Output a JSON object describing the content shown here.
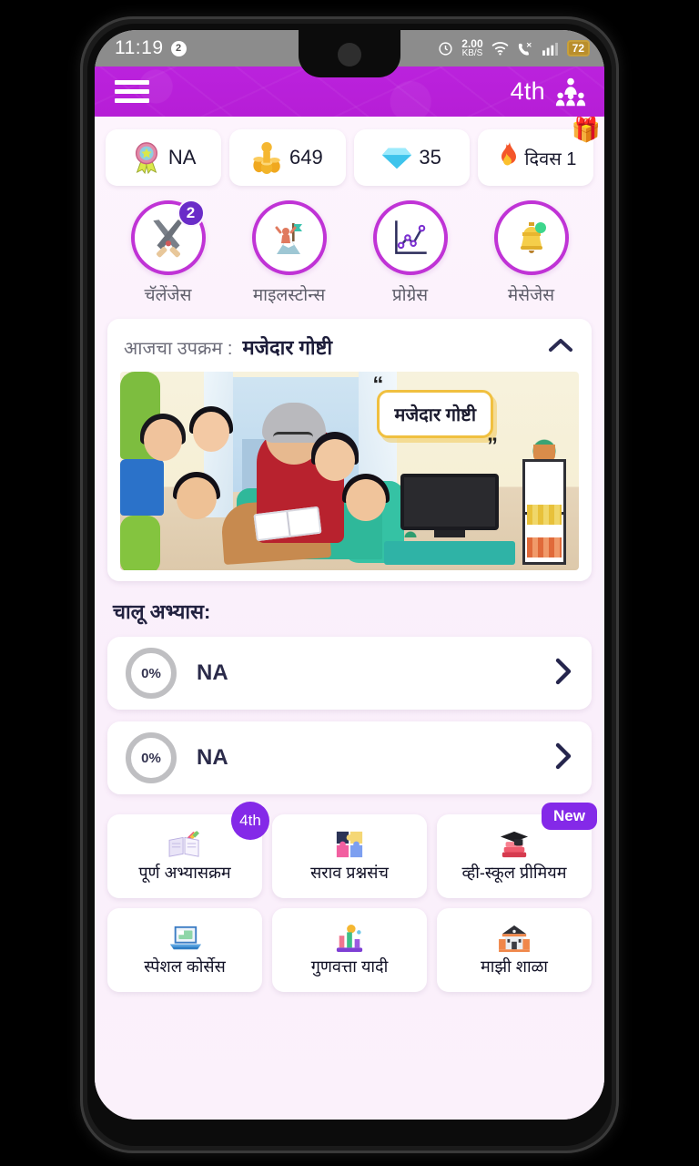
{
  "status_bar": {
    "time": "11:19",
    "notification_count": "2",
    "network_speed_value": "2.00",
    "network_speed_unit": "KB/S",
    "battery_percent": "72",
    "icons": [
      "alarm-clock-icon",
      "wifi-icon",
      "call-icon",
      "signal-icon",
      "battery-icon"
    ]
  },
  "header": {
    "menu_icon": "hamburger-menu-icon",
    "grade_label": "4th",
    "profile_icon": "group-people-icon",
    "background_color": "#b61ed6"
  },
  "stats": [
    {
      "icon": "award-ribbon-icon",
      "value": "NA"
    },
    {
      "icon": "coin-stack-icon",
      "value": "649"
    },
    {
      "icon": "diamond-icon",
      "value": "35"
    },
    {
      "icon": "fire-streak-icon",
      "value": "दिवस 1",
      "corner_icon": "gift-icon"
    }
  ],
  "nav_items": [
    {
      "icon": "crossed-swords-icon",
      "label": "चॅलेंजेस",
      "badge": "2"
    },
    {
      "icon": "mountain-flag-icon",
      "label": "माइलस्टोन्स",
      "badge": ""
    },
    {
      "icon": "line-chart-icon",
      "label": "प्रोग्रेस",
      "badge": ""
    },
    {
      "icon": "bell-icon",
      "label": "मेसेजेस",
      "badge": ""
    }
  ],
  "activity": {
    "label": "आजचा उपक्रम :",
    "title": "मजेदार गोष्टी",
    "toggle_icon": "chevron-up-icon",
    "illustration_bubble_text": "मजेदार गोष्टी",
    "illustration_alt": "grandmother-reading-story-to-children"
  },
  "current_studies": {
    "section_title": "चालू अभ्यास:",
    "rows": [
      {
        "progress": "0%",
        "name": "NA",
        "arrow_icon": "chevron-right-icon"
      },
      {
        "progress": "0%",
        "name": "NA",
        "arrow_icon": "chevron-right-icon"
      }
    ]
  },
  "tiles": [
    {
      "icon": "open-book-pencils-icon",
      "label": "पूर्ण अभ्यासक्रम",
      "badge": "4th",
      "badge_style": "round"
    },
    {
      "icon": "puzzle-pieces-icon",
      "label": "सराव प्रश्नसंच",
      "badge": "",
      "badge_style": ""
    },
    {
      "icon": "graduation-books-icon",
      "label": "व्ही-स्कूल प्रीमियम",
      "badge": "New",
      "badge_style": "pill"
    },
    {
      "icon": "laptop-icon",
      "label": "स्पेशल कोर्सेस",
      "badge": "",
      "badge_style": ""
    },
    {
      "icon": "podium-chart-icon",
      "label": "गुणवत्ता यादी",
      "badge": "",
      "badge_style": ""
    },
    {
      "icon": "school-building-icon",
      "label": "माझी शाळा",
      "badge": "",
      "badge_style": ""
    }
  ],
  "colors": {
    "brand_purple": "#b61ed6",
    "badge_purple": "#8429e8",
    "nav_ring": "#c033d6",
    "page_bg": "#faf2fb"
  }
}
